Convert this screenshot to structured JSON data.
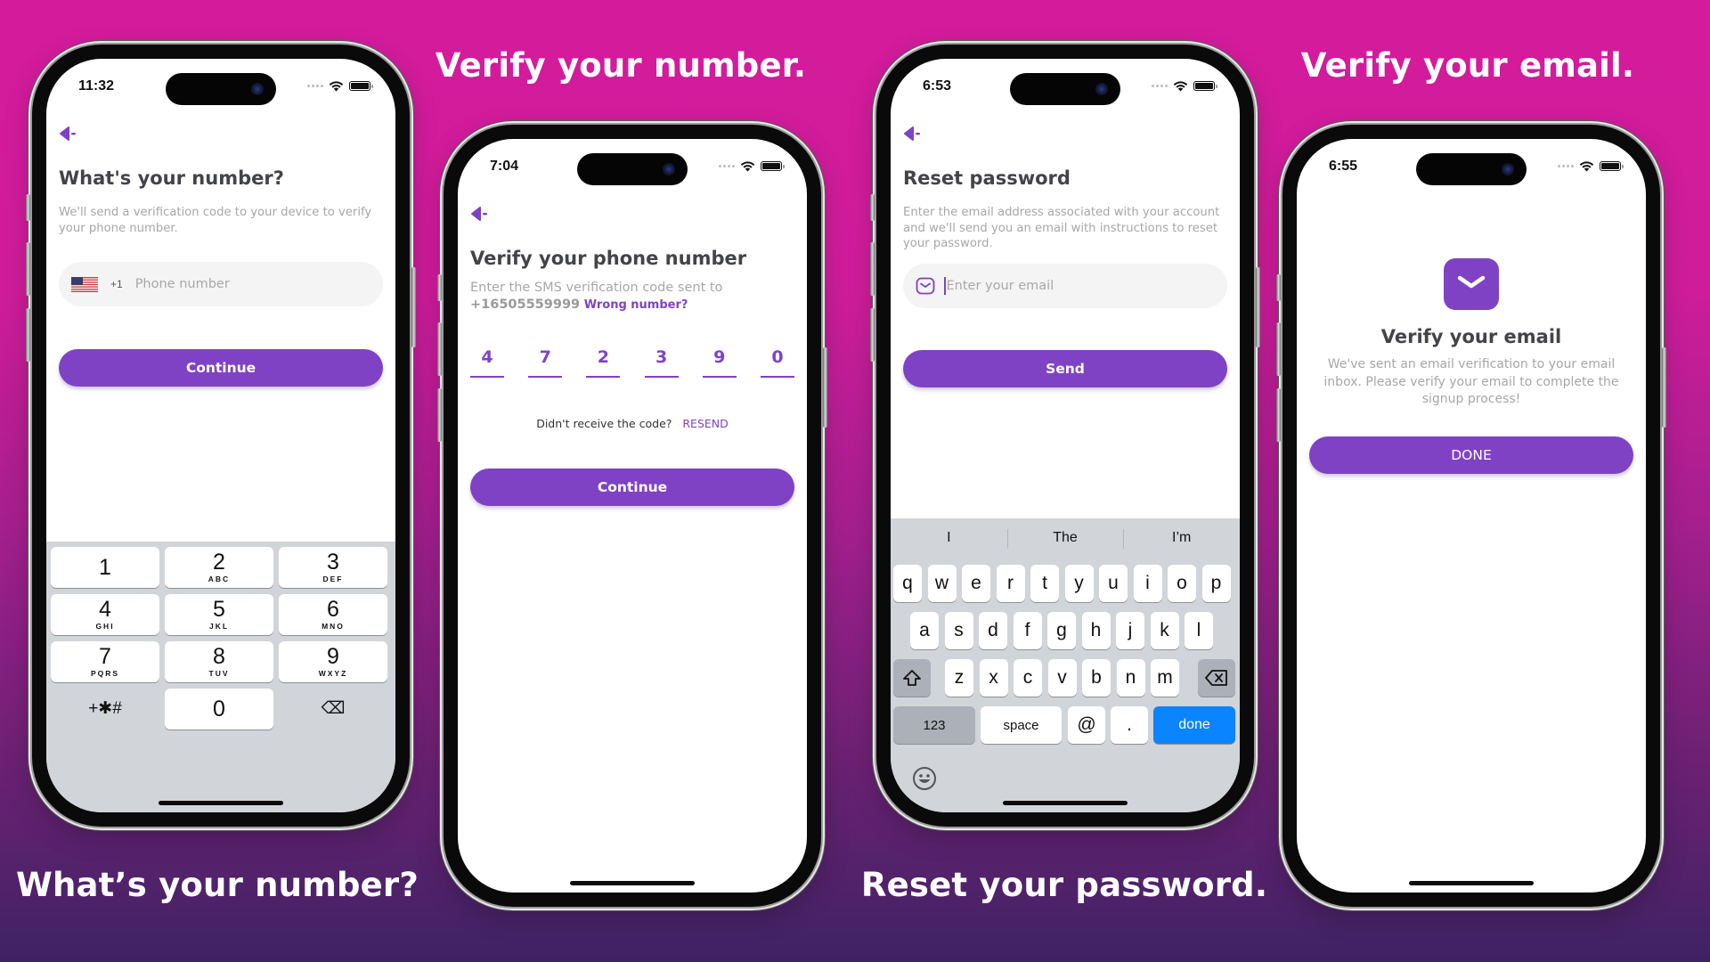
{
  "colors": {
    "brand_purple": "#7f42c4",
    "bg_top": "#d41b9c",
    "bg_bottom": "#3f2264",
    "keyboard_blue": "#0a84ff"
  },
  "captions": {
    "verify_number": "Verify your number.",
    "verify_email": "Verify your email.",
    "whats_number": "What’s your number?",
    "reset_password": "Reset your password."
  },
  "screens": {
    "phone_entry": {
      "time": "11:32",
      "back_icon": "back-arrow-icon",
      "title": "What's your number?",
      "subtitle": "We'll send a verification code to your device to verify your phone number.",
      "country_flag": "us-flag-icon",
      "country_code": "+1",
      "phone_placeholder": "Phone number",
      "continue_label": "Continue",
      "keypad": [
        {
          "digit": "1",
          "letters": ""
        },
        {
          "digit": "2",
          "letters": "ABC"
        },
        {
          "digit": "3",
          "letters": "DEF"
        },
        {
          "digit": "4",
          "letters": "GHI"
        },
        {
          "digit": "5",
          "letters": "JKL"
        },
        {
          "digit": "6",
          "letters": "MNO"
        },
        {
          "digit": "7",
          "letters": "PQRS"
        },
        {
          "digit": "8",
          "letters": "TUV"
        },
        {
          "digit": "9",
          "letters": "WXYZ"
        },
        {
          "digit": "+✱#",
          "letters": ""
        },
        {
          "digit": "0",
          "letters": ""
        },
        {
          "digit": "⌫",
          "letters": ""
        }
      ]
    },
    "verify_phone": {
      "time": "7:04",
      "title": "Verify your phone number",
      "subtitle": "Enter the SMS verification code sent to",
      "phone_number": "+16505559999",
      "wrong_number_link": "Wrong number?",
      "otp_digits": [
        "4",
        "7",
        "2",
        "3",
        "9",
        "0"
      ],
      "resend_prompt": "Didn't receive the code?",
      "resend_link": "RESEND",
      "continue_label": "Continue"
    },
    "reset_password": {
      "time": "6:53",
      "title": "Reset password",
      "subtitle": "Enter the email address associated with your account and we'll send you an email with instructions to reset your password.",
      "email_placeholder": "Enter your email",
      "send_label": "Send",
      "suggestions": [
        "I",
        "The",
        "I’m"
      ],
      "keyboard": {
        "row1": [
          "q",
          "w",
          "e",
          "r",
          "t",
          "y",
          "u",
          "i",
          "o",
          "p"
        ],
        "row2": [
          "a",
          "s",
          "d",
          "f",
          "g",
          "h",
          "j",
          "k",
          "l"
        ],
        "row3": [
          "z",
          "x",
          "c",
          "v",
          "b",
          "n",
          "m"
        ],
        "numbers_label": "123",
        "space_label": "space",
        "at_label": "@",
        "dot_label": ".",
        "done_label": "done"
      }
    },
    "verify_email": {
      "time": "6:55",
      "title": "Verify your email",
      "message": "We've sent an email verification to your email inbox. Please verify your email to complete the signup process!",
      "done_label": "DONE"
    }
  }
}
